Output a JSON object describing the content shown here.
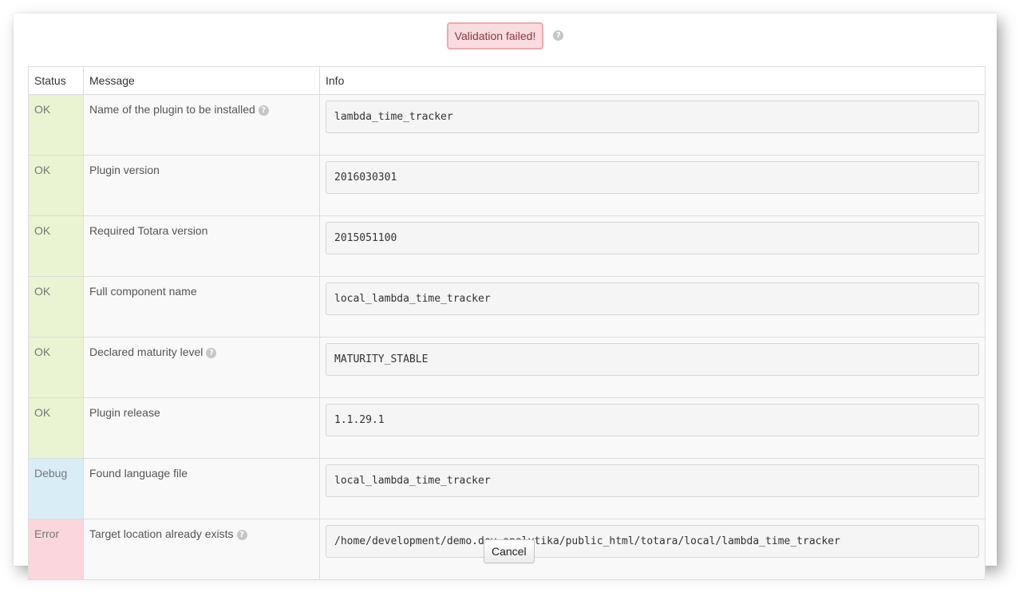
{
  "header": {
    "validation_status": "Validation failed!",
    "help_icon": "question-circle-icon"
  },
  "table": {
    "columns": {
      "status": "Status",
      "message": "Message",
      "info": "Info"
    },
    "rows": [
      {
        "status": "OK",
        "message": "Name of the plugin to be installed",
        "has_help": true,
        "info": "lambda_time_tracker"
      },
      {
        "status": "OK",
        "message": "Plugin version",
        "has_help": false,
        "info": "2016030301"
      },
      {
        "status": "OK",
        "message": "Required Totara version",
        "has_help": false,
        "info": "2015051100"
      },
      {
        "status": "OK",
        "message": "Full component name",
        "has_help": false,
        "info": "local_lambda_time_tracker"
      },
      {
        "status": "OK",
        "message": "Declared maturity level",
        "has_help": true,
        "info": "MATURITY_STABLE"
      },
      {
        "status": "OK",
        "message": "Plugin release",
        "has_help": false,
        "info": "1.1.29.1"
      },
      {
        "status": "Debug",
        "message": "Found language file",
        "has_help": false,
        "info": "local_lambda_time_tracker"
      },
      {
        "status": "Error",
        "message": "Target location already exists",
        "has_help": true,
        "info": "/home/development/demo.dev.analytika/public_html/totara/local/lambda_time_tracker"
      }
    ]
  },
  "footer": {
    "cancel_label": "Cancel"
  },
  "colors": {
    "ok": "#eaf3d2",
    "debug": "#d9edf7",
    "error": "#fbd6dc",
    "badge": "#f9dcdf"
  }
}
